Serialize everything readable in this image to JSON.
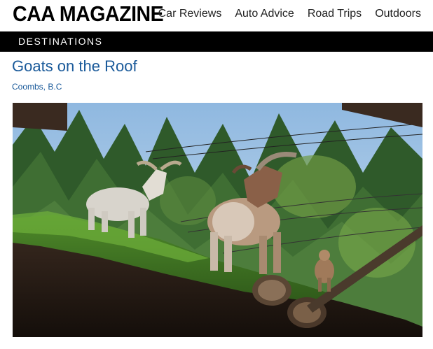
{
  "header": {
    "logo": "CAA MAGAZINE",
    "nav": [
      "Car Reviews",
      "Auto Advice",
      "Road Trips",
      "Outdoors"
    ]
  },
  "section": {
    "label": "DESTINATIONS"
  },
  "article": {
    "title": "Goats on the Roof",
    "location": "Coombs, B.C"
  },
  "colors": {
    "title_link": "#1a5a9a",
    "section_bar": "#000000",
    "section_text": "#ffffff"
  }
}
